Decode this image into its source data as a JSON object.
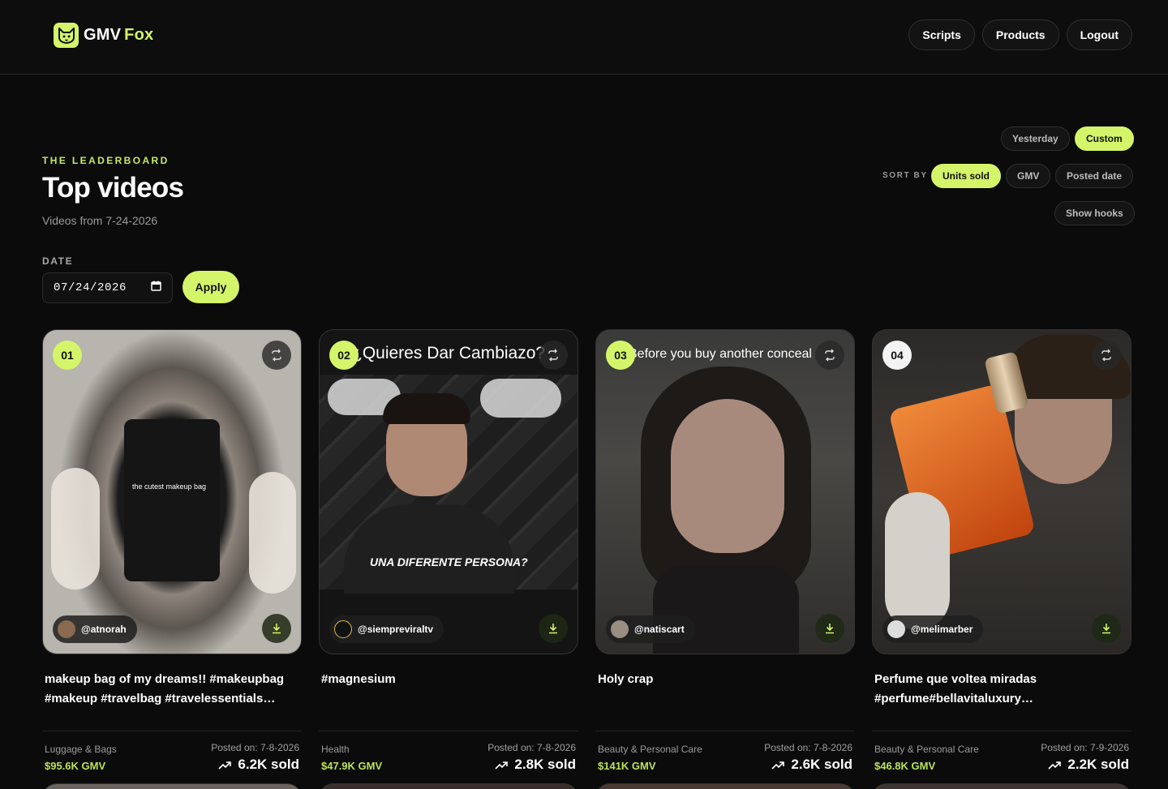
{
  "header": {
    "logo_word1": "GMV",
    "logo_word2": "Fox",
    "nav": [
      {
        "label": "Scripts"
      },
      {
        "label": "Products"
      },
      {
        "label": "Logout"
      }
    ]
  },
  "hero": {
    "eyebrow": "THE LEADERBOARD",
    "title": "Top videos",
    "subtitle": "Videos from 7-24-2026"
  },
  "date_filter": {
    "label": "DATE",
    "value": "07/24/2026",
    "apply_label": "Apply"
  },
  "range": {
    "yesterday_label": "Yesterday",
    "custom_label": "Custom",
    "selected": "Custom"
  },
  "sort": {
    "label": "SORT BY",
    "units_label": "Units sold",
    "gmv_label": "GMV",
    "posted_label": "Posted date",
    "selected": "Units sold"
  },
  "hooks_label": "Show hooks",
  "colors": {
    "accent": "#d4f56a",
    "gmv": "#b9e35a",
    "background": "#0b0b0b"
  },
  "cards": [
    {
      "rank": "01",
      "handle": "@atnorah",
      "overlay": "the cutest makeup bag",
      "description": "makeup bag of my dreams!! #makeupbag #makeup #travelbag #travelessentials…",
      "category": "Luggage & Bags",
      "gmv": "$95.6K GMV",
      "posted": "Posted on: 7-8-2026",
      "sold": "6.2K sold"
    },
    {
      "rank": "02",
      "handle": "@siempreviraltv",
      "overlay": "¿Quieres Dar Cambiazo?",
      "overlay2": "UNA DIFERENTE PERSONA?",
      "description": "#magnesium",
      "category": "Health",
      "gmv": "$47.9K GMV",
      "posted": "Posted on: 7-8-2026",
      "sold": "2.8K sold"
    },
    {
      "rank": "03",
      "handle": "@natiscart",
      "overlay": "Before you buy another conceal",
      "description": "Holy crap",
      "category": "Beauty & Personal Care",
      "gmv": "$141K GMV",
      "posted": "Posted on: 7-8-2026",
      "sold": "2.6K sold"
    },
    {
      "rank": "04",
      "handle": "@melimarber",
      "description": "Perfume que voltea miradas #perfume#bellavitaluxury…",
      "category": "Beauty & Personal Care",
      "gmv": "$46.8K GMV",
      "posted": "Posted on: 7-9-2026",
      "sold": "2.2K sold"
    }
  ]
}
